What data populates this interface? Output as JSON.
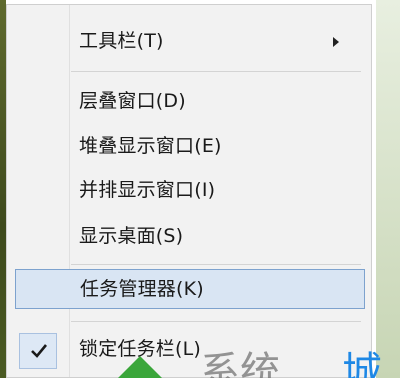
{
  "context_menu": {
    "items": [
      {
        "label": "工具栏(T)",
        "has_submenu": true
      },
      {
        "label": "层叠窗口(D)"
      },
      {
        "label": "堆叠显示窗口(E)"
      },
      {
        "label": "并排显示窗口(I)"
      },
      {
        "label": "显示桌面(S)"
      },
      {
        "label": "任务管理器(K)",
        "highlighted": true
      },
      {
        "label": "锁定任务栏(L)",
        "checked": true
      }
    ]
  },
  "watermark": {
    "text_gray": "系统",
    "text_blue": "城"
  },
  "colors": {
    "menu_bg": "#f2f2f2",
    "highlight_bg": "#d9e5f3",
    "highlight_border": "#7da2ce",
    "separator": "#d4d4d4"
  }
}
